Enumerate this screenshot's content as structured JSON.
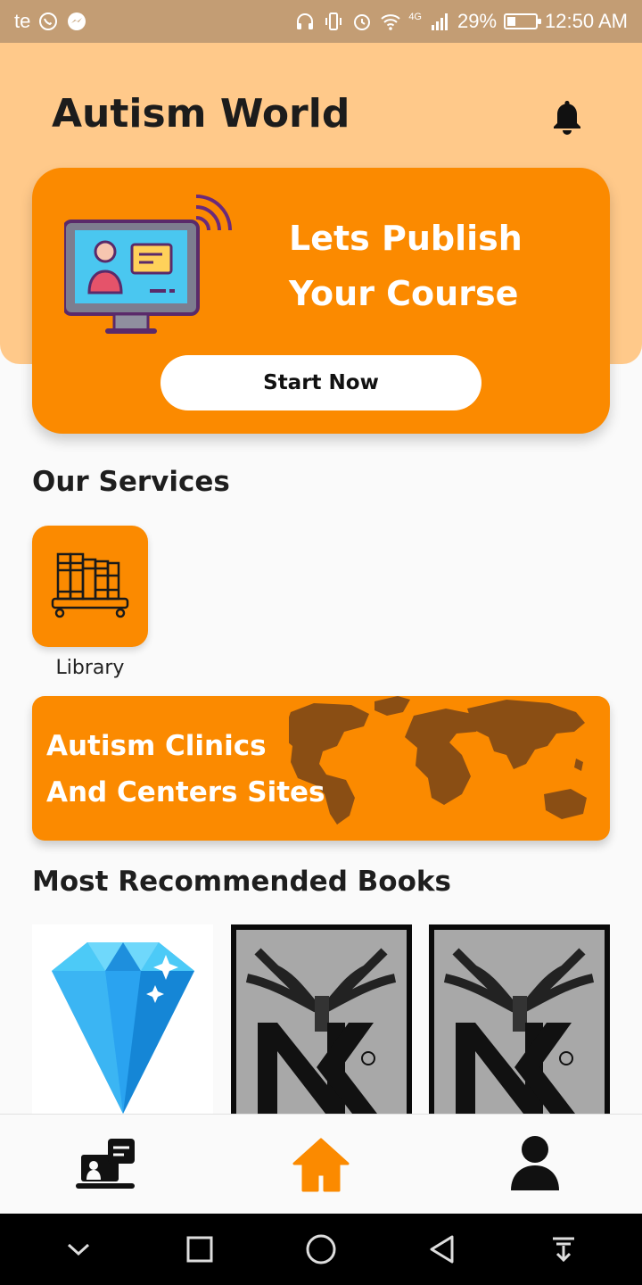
{
  "status_bar": {
    "carrier": "te",
    "network": "4G",
    "battery": "29%",
    "battery_level": 0.29,
    "time": "12:50 AM",
    "icons": [
      "whatsapp-icon",
      "messenger-icon",
      "headphones-icon",
      "vibrate-icon",
      "alarm-icon",
      "wifi-icon",
      "signal-icon",
      "battery-icon"
    ]
  },
  "header": {
    "title": "Autism World",
    "notification_icon": "bell-icon"
  },
  "promo": {
    "title_line1": "Lets Publish",
    "title_line2": "Your Course",
    "button_label": "Start Now",
    "illustration": "online-teacher-monitor-icon"
  },
  "services": {
    "title": "Our Services",
    "items": [
      {
        "label": "Library",
        "icon": "library-bookshelf-icon"
      }
    ]
  },
  "clinics_banner": {
    "line1": "Autism Clinics",
    "line2": "And Centers Sites",
    "background": "world-map"
  },
  "books": {
    "title": "Most Recommended Books",
    "items": [
      {
        "cover": "diamond-cover"
      },
      {
        "cover": "nk-logo-cover"
      },
      {
        "cover": "nk-logo-cover"
      }
    ]
  },
  "bottom_nav": {
    "items": [
      {
        "icon": "courses-icon",
        "active": false
      },
      {
        "icon": "home-icon",
        "active": true
      },
      {
        "icon": "profile-icon",
        "active": false
      }
    ]
  },
  "system_nav": [
    "dropdown-icon",
    "recents-icon",
    "home-circle-icon",
    "back-icon",
    "notification-pull-icon"
  ],
  "colors": {
    "primary": "#fb8a00",
    "header_bg": "#ffc98a",
    "status_bar": "#c39d74",
    "text_dark": "#1c1c1c"
  }
}
